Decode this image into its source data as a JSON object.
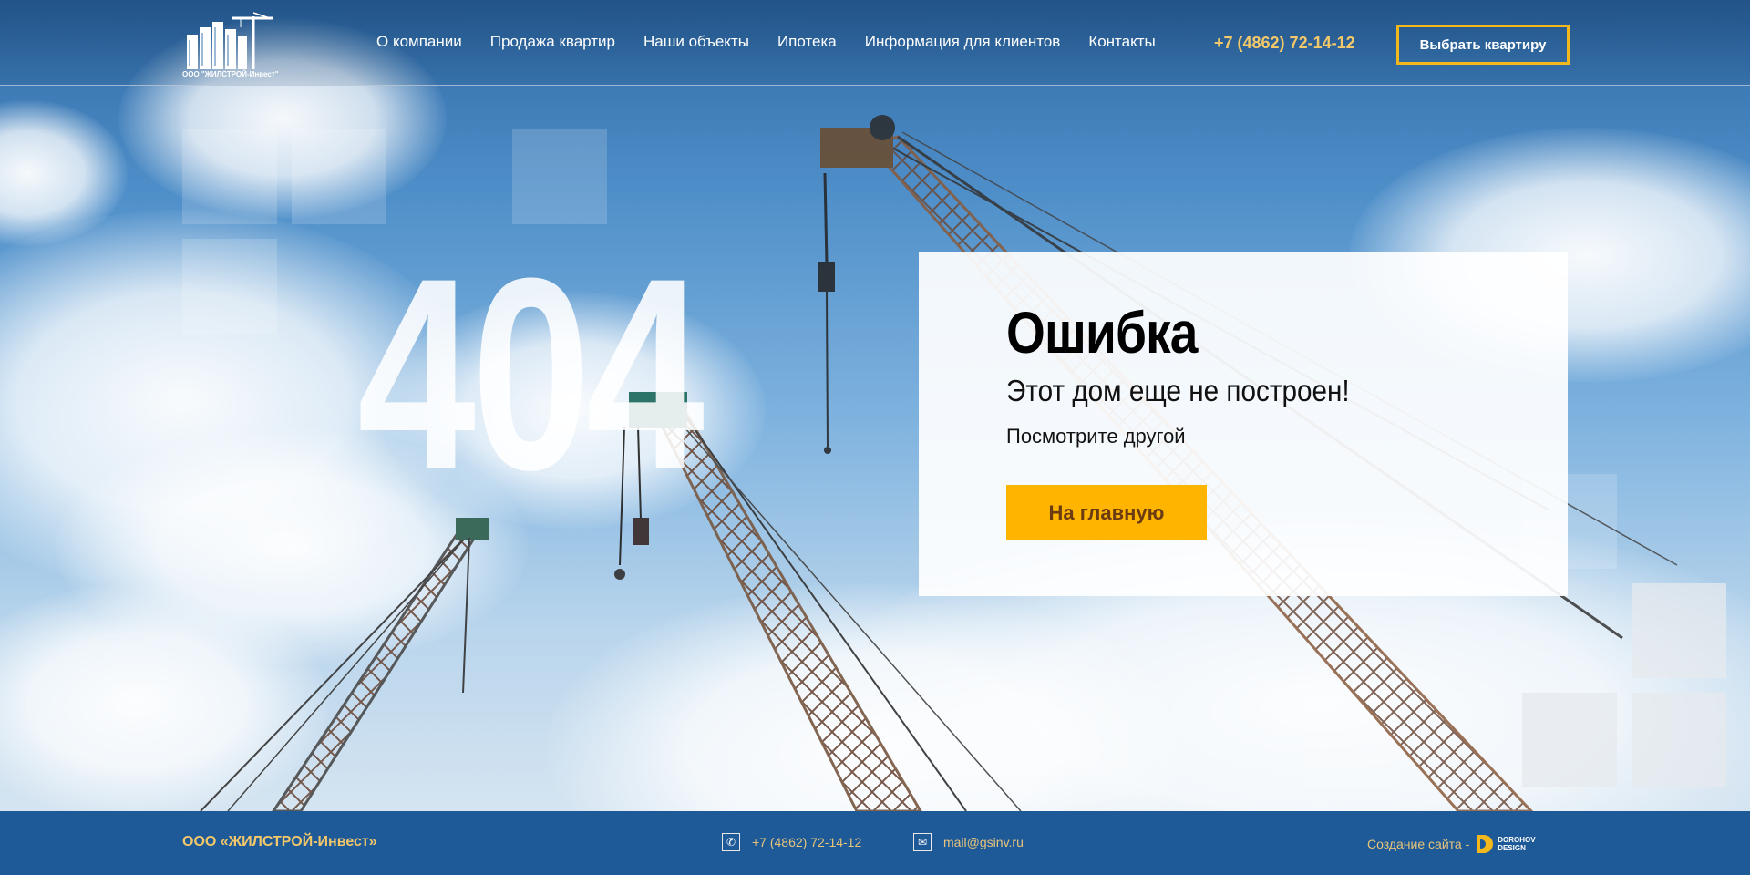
{
  "header": {
    "logo_text": "ООО \"ЖИЛСТРОЙ-Инвест\"",
    "nav": [
      "О компании",
      "Продажа квартир",
      "Наши объекты",
      "Ипотека",
      "Информация для клиентов",
      "Контакты"
    ],
    "phone": "+7 (4862) 72-14-12",
    "choose_button": "Выбрать квартиру"
  },
  "hero": {
    "code": "404"
  },
  "card": {
    "title": "Ошибка",
    "subtitle": "Этот дом еще не построен!",
    "text": "Посмотрите другой",
    "home_button": "На главную"
  },
  "footer": {
    "company": "ООО «ЖИЛСТРОЙ-Инвест»",
    "phone": "+7 (4862) 72-14-12",
    "email": "mail@gsinv.ru",
    "credit_label": "Создание сайта -",
    "credit_brand_line1": "DOROHOV",
    "credit_brand_line2": "DESIGN"
  },
  "colors": {
    "accent_yellow": "#ffb400",
    "phone_gold": "#f3c86a",
    "footer_blue": "#1f5a98"
  }
}
